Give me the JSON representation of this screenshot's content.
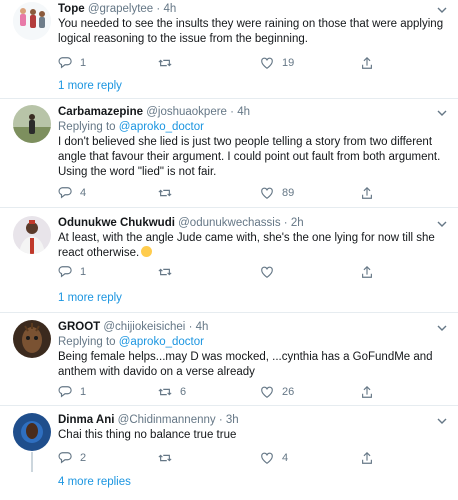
{
  "tweets": [
    {
      "name": "Tope",
      "handle": "@grapelytee",
      "time": "4h",
      "text": "You needed to see the insults they were raining on those that were applying logical reasoning to the issue from the beginning.",
      "reply_count": "1",
      "retweet_count": "",
      "like_count": "19",
      "more": "1 more reply"
    },
    {
      "name": "Carbamazepine",
      "handle": "@joshuaokpere",
      "time": "4h",
      "replying_prefix": "Replying to",
      "replying_to": "@aproko_doctor",
      "text": "I don't believed she lied is just two people telling a story from two different angle that favour their argument. I could point out fault from both argument. Using the word \"lied\" is not fair.",
      "reply_count": "4",
      "retweet_count": "",
      "like_count": "89"
    },
    {
      "name": "Odunukwe Chukwudi",
      "handle": "@odunukwechassis",
      "time": "2h",
      "text": "At least, with the angle Jude came with, she's the one lying for now till she react otherwise.",
      "reply_count": "1",
      "retweet_count": "",
      "like_count": "",
      "more": "1 more reply"
    },
    {
      "name": "GROOT",
      "handle": "@chijiokeisichei",
      "time": "4h",
      "replying_prefix": "Replying to",
      "replying_to": "@aproko_doctor",
      "text": "Being female helps...may D was mocked, ...cynthia has a GoFundMe and anthem with davido on a verse already",
      "reply_count": "1",
      "retweet_count": "6",
      "like_count": "26"
    },
    {
      "name": "Dinma Ani",
      "handle": "@Chidinmannenny",
      "time": "3h",
      "text": "Chai this thing no balance true true",
      "reply_count": "2",
      "retweet_count": "",
      "like_count": "4",
      "more": "4 more replies"
    }
  ],
  "separator": "·",
  "icons": [
    "reply-icon",
    "retweet-icon",
    "like-icon",
    "share-icon",
    "chevron-down-icon",
    "emoji-icon"
  ],
  "colors": {
    "link": "#1b95e0",
    "muted": "#657786",
    "divider": "#e6ecf0",
    "thread": "#ccd6dd"
  }
}
